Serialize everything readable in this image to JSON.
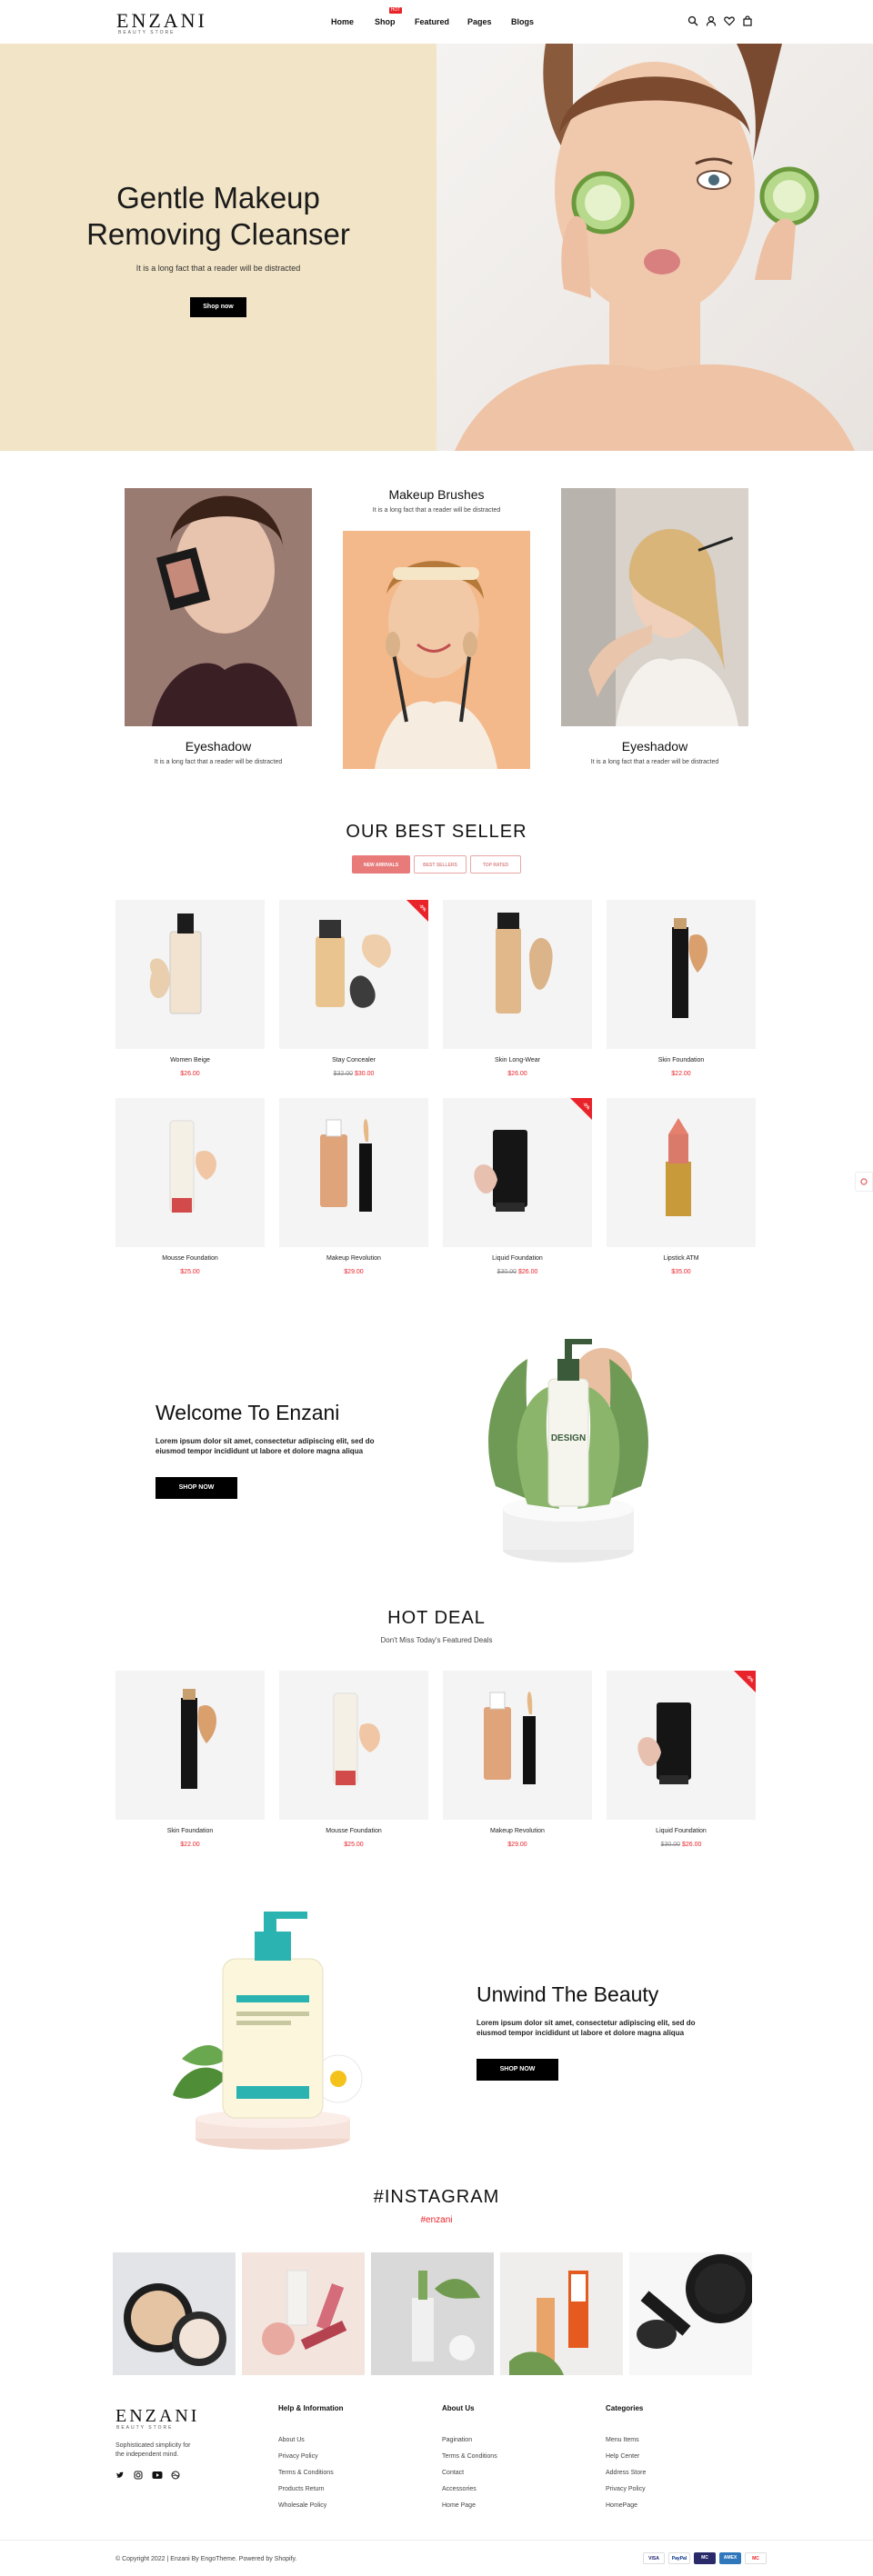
{
  "brand": {
    "name": "ENZANI",
    "tagline": "BEAUTY STORE"
  },
  "nav": {
    "items": [
      "Home",
      "Shop",
      "Featured",
      "Pages",
      "Blogs"
    ],
    "hot_badge": "HOT"
  },
  "hero": {
    "title": "Gentle Makeup Removing Cleanser",
    "subtitle": "It is a long fact that a reader will be distracted",
    "button": "Shop now"
  },
  "categories": [
    {
      "title": "Eyeshadow",
      "subtitle": "It is a long fact that a reader will be distracted"
    },
    {
      "title": "Makeup Brushes",
      "subtitle": "It is a long fact that a reader will be distracted"
    },
    {
      "title": "Eyeshadow",
      "subtitle": "It is a long fact that a reader will be distracted"
    }
  ],
  "best_seller": {
    "title": "OUR BEST SELLER",
    "tabs": [
      "NEW ARRIVALS",
      "BEST SELLERS",
      "TOP RATED"
    ],
    "products": [
      {
        "name": "Women Beige",
        "price": "$26.00",
        "old": "",
        "sale": false
      },
      {
        "name": "Stay Concealer",
        "price": "$30.00",
        "old": "$32.00",
        "sale": true
      },
      {
        "name": "Skin Long-Wear",
        "price": "$26.00",
        "old": "",
        "sale": false
      },
      {
        "name": "Skin Foundation",
        "price": "$22.00",
        "old": "",
        "sale": false
      },
      {
        "name": "Mousse Foundation",
        "price": "$25.00",
        "old": "",
        "sale": false
      },
      {
        "name": "Makeup Revolution",
        "price": "$29.00",
        "old": "",
        "sale": false
      },
      {
        "name": "Liquid Foundation",
        "price": "$26.00",
        "old": "$30.00",
        "sale": true
      },
      {
        "name": "Lipstick ATM",
        "price": "$35.00",
        "old": "",
        "sale": false
      }
    ],
    "sale_label": "-5%"
  },
  "welcome": {
    "title": "Welcome To Enzani",
    "text": "Lorem ipsum dolor sit amet, consectetur adipiscing elit, sed do eiusmod tempor incididunt ut labore et dolore magna aliqua",
    "button": "SHOP NOW",
    "bottle_label": "DESIGN"
  },
  "hot_deal": {
    "title": "HOT DEAL",
    "subtitle": "Don't Miss Today's Featured Deals",
    "products": [
      {
        "name": "Skin Foundation",
        "price": "$22.00",
        "old": "",
        "sale": false
      },
      {
        "name": "Mousse Foundation",
        "price": "$25.00",
        "old": "",
        "sale": false
      },
      {
        "name": "Makeup Revolution",
        "price": "$29.00",
        "old": "",
        "sale": false
      },
      {
        "name": "Liquid Foundation",
        "price": "$26.00",
        "old": "$30.00",
        "sale": true
      }
    ]
  },
  "unwind": {
    "title": "Unwind The Beauty",
    "text": "Lorem ipsum dolor sit amet, consectetur adipiscing elit, sed do eiusmod tempor incididunt ut labore et dolore magna aliqua",
    "button": "SHOP NOW"
  },
  "instagram": {
    "title": "#INSTAGRAM",
    "handle": "#enzani"
  },
  "footer": {
    "about": "Sophisticated simplicity for the independent mind.",
    "columns": [
      {
        "head": "Help & Information",
        "links": [
          "About Us",
          "Privacy Policy",
          "Terms & Conditions",
          "Products Return",
          "Wholesale Policy"
        ]
      },
      {
        "head": "About Us",
        "links": [
          "Pagination",
          "Terms & Conditions",
          "Contact",
          "Accessories",
          "Home Page"
        ]
      },
      {
        "head": "Categories",
        "links": [
          "Menu Items",
          "Help Center",
          "Address Store",
          "Privacy Policy",
          "HomePage"
        ]
      }
    ],
    "copyright": "© Copyright 2022 | Enzani By EngoTheme. Powered by Shopify.",
    "payments": [
      "VISA",
      "PayPal",
      "MC",
      "AMEX",
      "MC"
    ]
  },
  "colors": {
    "accent": "#e8232a",
    "hero_bg": "#f2e4c6",
    "tab_active": "#e87a7a"
  }
}
